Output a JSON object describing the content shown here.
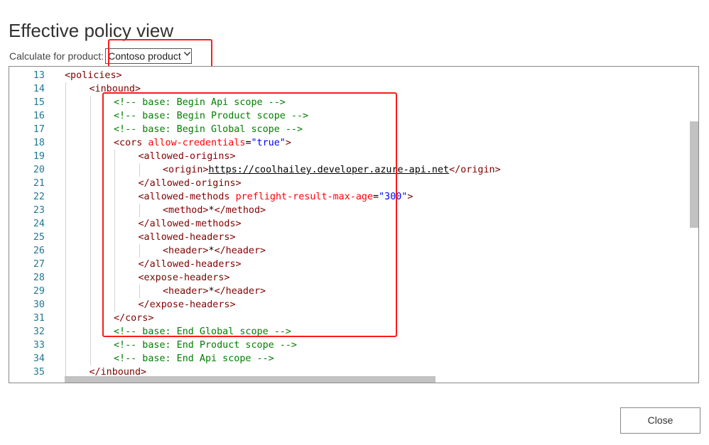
{
  "page": {
    "title": "Effective policy view"
  },
  "calculate": {
    "label": "Calculate for product:",
    "selected": "Contoso product"
  },
  "editor": {
    "lines": [
      {
        "num": "13",
        "indent": 0,
        "tokens": [
          {
            "t": "tag",
            "v": "<policies>"
          }
        ]
      },
      {
        "num": "14",
        "indent": 1,
        "tokens": [
          {
            "t": "tag",
            "v": "<inbound>"
          }
        ]
      },
      {
        "num": "15",
        "indent": 2,
        "tokens": [
          {
            "t": "com",
            "v": "<!-- base: Begin Api scope -->"
          }
        ]
      },
      {
        "num": "16",
        "indent": 2,
        "tokens": [
          {
            "t": "com",
            "v": "<!-- base: Begin Product scope -->"
          }
        ]
      },
      {
        "num": "17",
        "indent": 2,
        "tokens": [
          {
            "t": "com",
            "v": "<!-- base: Begin Global scope -->"
          }
        ]
      },
      {
        "num": "18",
        "indent": 2,
        "tokens": [
          {
            "t": "tag",
            "v": "<cors "
          },
          {
            "t": "attr",
            "v": "allow-credentials"
          },
          {
            "t": "text",
            "v": "="
          },
          {
            "t": "val",
            "v": "\"true\""
          },
          {
            "t": "tag",
            "v": ">"
          }
        ]
      },
      {
        "num": "19",
        "indent": 3,
        "tokens": [
          {
            "t": "tag",
            "v": "<allowed-origins>"
          }
        ]
      },
      {
        "num": "20",
        "indent": 4,
        "tokens": [
          {
            "t": "tag",
            "v": "<origin>"
          },
          {
            "t": "url",
            "v": "https://coolhailey.developer.azure-api.net"
          },
          {
            "t": "tag",
            "v": "</origin>"
          }
        ]
      },
      {
        "num": "21",
        "indent": 3,
        "tokens": [
          {
            "t": "tag",
            "v": "</allowed-origins>"
          }
        ]
      },
      {
        "num": "22",
        "indent": 3,
        "tokens": [
          {
            "t": "tag",
            "v": "<allowed-methods "
          },
          {
            "t": "attr",
            "v": "preflight-result-max-age"
          },
          {
            "t": "text",
            "v": "="
          },
          {
            "t": "val",
            "v": "\"300\""
          },
          {
            "t": "tag",
            "v": ">"
          }
        ]
      },
      {
        "num": "23",
        "indent": 4,
        "tokens": [
          {
            "t": "tag",
            "v": "<method>"
          },
          {
            "t": "text",
            "v": "*"
          },
          {
            "t": "tag",
            "v": "</method>"
          }
        ]
      },
      {
        "num": "24",
        "indent": 3,
        "tokens": [
          {
            "t": "tag",
            "v": "</allowed-methods>"
          }
        ]
      },
      {
        "num": "25",
        "indent": 3,
        "tokens": [
          {
            "t": "tag",
            "v": "<allowed-headers>"
          }
        ]
      },
      {
        "num": "26",
        "indent": 4,
        "tokens": [
          {
            "t": "tag",
            "v": "<header>"
          },
          {
            "t": "text",
            "v": "*"
          },
          {
            "t": "tag",
            "v": "</header>"
          }
        ]
      },
      {
        "num": "27",
        "indent": 3,
        "tokens": [
          {
            "t": "tag",
            "v": "</allowed-headers>"
          }
        ]
      },
      {
        "num": "28",
        "indent": 3,
        "tokens": [
          {
            "t": "tag",
            "v": "<expose-headers>"
          }
        ]
      },
      {
        "num": "29",
        "indent": 4,
        "tokens": [
          {
            "t": "tag",
            "v": "<header>"
          },
          {
            "t": "text",
            "v": "*"
          },
          {
            "t": "tag",
            "v": "</header>"
          }
        ]
      },
      {
        "num": "30",
        "indent": 3,
        "tokens": [
          {
            "t": "tag",
            "v": "</expose-headers>"
          }
        ]
      },
      {
        "num": "31",
        "indent": 2,
        "tokens": [
          {
            "t": "tag",
            "v": "</cors>"
          }
        ]
      },
      {
        "num": "32",
        "indent": 2,
        "tokens": [
          {
            "t": "com",
            "v": "<!-- base: End Global scope -->"
          }
        ]
      },
      {
        "num": "33",
        "indent": 2,
        "tokens": [
          {
            "t": "com",
            "v": "<!-- base: End Product scope -->"
          }
        ]
      },
      {
        "num": "34",
        "indent": 2,
        "tokens": [
          {
            "t": "com",
            "v": "<!-- base: End Api scope -->"
          }
        ]
      },
      {
        "num": "35",
        "indent": 1,
        "tokens": [
          {
            "t": "tag",
            "v": "</inbound>"
          }
        ]
      }
    ]
  },
  "footer": {
    "close_label": "Close"
  },
  "colors": {
    "highlight": "#ff1a1a",
    "line_number": "#237893",
    "tag": "#800000",
    "attribute": "#ff0000",
    "value": "#0000ff",
    "comment": "#008000"
  },
  "icons": {
    "dropdown": "chevron-down-icon"
  }
}
